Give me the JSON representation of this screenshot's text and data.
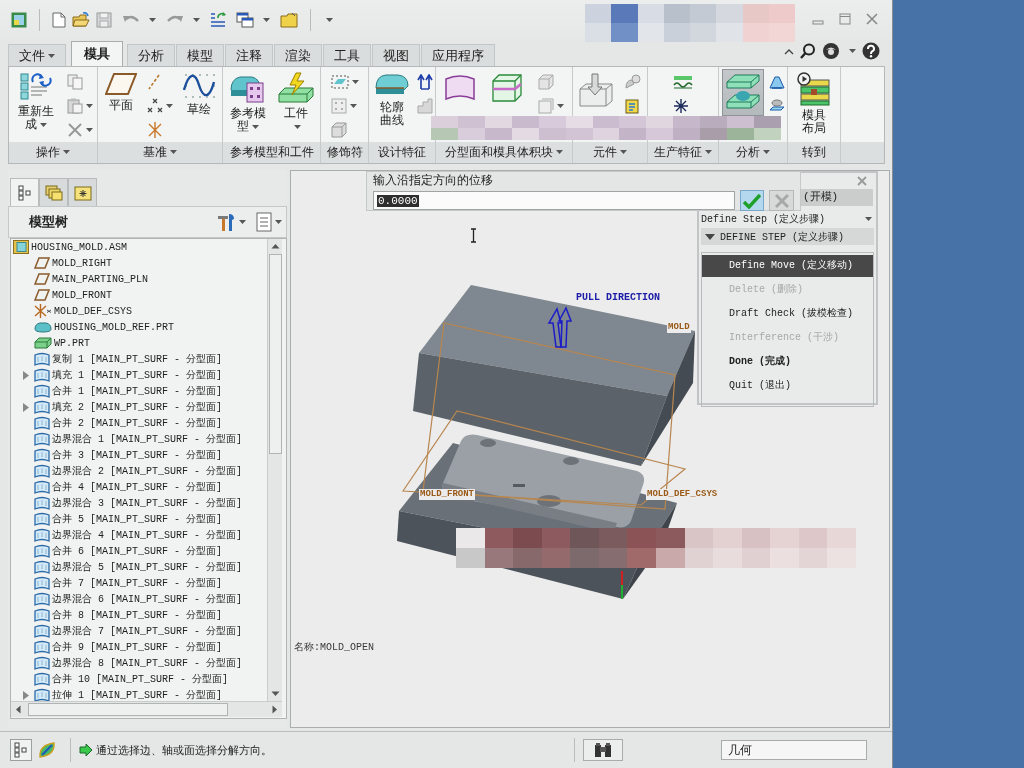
{
  "ribbon": {
    "tabs": [
      {
        "label": "文件",
        "menu": true,
        "selected": false
      },
      {
        "label": "模具",
        "menu": false,
        "selected": true
      },
      {
        "label": "分析",
        "menu": false,
        "selected": false
      },
      {
        "label": "模型",
        "menu": false,
        "selected": false
      },
      {
        "label": "注释",
        "menu": false,
        "selected": false
      },
      {
        "label": "渲染",
        "menu": false,
        "selected": false
      },
      {
        "label": "工具",
        "menu": false,
        "selected": false
      },
      {
        "label": "视图",
        "menu": false,
        "selected": false
      },
      {
        "label": "应用程序",
        "menu": false,
        "selected": false
      }
    ],
    "groups": [
      {
        "label": "操作",
        "menu": true,
        "buttons": [
          {
            "label": "重新生成",
            "menu": true,
            "pressed": false
          }
        ]
      },
      {
        "label": "基准",
        "menu": true,
        "buttons": [
          {
            "label": "平面",
            "menu": false,
            "pressed": false
          },
          {
            "label": "草绘",
            "menu": false,
            "pressed": false
          }
        ]
      },
      {
        "label": "参考模型和工件",
        "menu": false,
        "buttons": [
          {
            "label": "参考模型",
            "menu": true,
            "pressed": false
          },
          {
            "label": "工件",
            "menu": true,
            "pressed": false
          }
        ]
      },
      {
        "label": "修饰符",
        "menu": false
      },
      {
        "label": "设计特征",
        "menu": false,
        "buttons": [
          {
            "label": "轮廓曲线",
            "menu": false,
            "pressed": false
          }
        ]
      },
      {
        "label": "分型面和模具体积块",
        "menu": true
      },
      {
        "label": "元件",
        "menu": true
      },
      {
        "label": "生产特征",
        "menu": true
      },
      {
        "label": "分析",
        "menu": true,
        "buttons": [
          {
            "menu": false,
            "pressed": true
          }
        ]
      },
      {
        "label": "转到",
        "menu": false,
        "buttons": [
          {
            "label": "模具布局",
            "menu": false,
            "pressed": false
          }
        ]
      }
    ]
  },
  "model_tree": {
    "tabs": [
      {
        "selected": true
      },
      {
        "selected": false
      },
      {
        "selected": false
      }
    ],
    "title": "模型树",
    "root": {
      "label": "HOUSING_MOLD.ASM",
      "kind": "assembly",
      "children": [
        {
          "label": "MOLD_RIGHT",
          "kind": "plane",
          "expandable": false
        },
        {
          "label": "MAIN_PARTING_PLN",
          "kind": "plane",
          "expandable": false
        },
        {
          "label": "MOLD_FRONT",
          "kind": "plane",
          "expandable": false
        },
        {
          "label": "MOLD_DEF_CSYS",
          "kind": "csys",
          "expandable": false
        },
        {
          "label": "HOUSING_MOLD_REF.PRT",
          "kind": "part",
          "expandable": false
        },
        {
          "label": "WP.PRT",
          "kind": "workpiece",
          "expandable": false
        },
        {
          "label": "复制 1 [MAIN_PT_SURF - 分型面]",
          "kind": "surface",
          "expandable": false
        },
        {
          "label": "填充 1 [MAIN_PT_SURF - 分型面]",
          "kind": "surface",
          "expandable": true
        },
        {
          "label": "合并 1 [MAIN_PT_SURF - 分型面]",
          "kind": "surface",
          "expandable": false
        },
        {
          "label": "填充 2 [MAIN_PT_SURF - 分型面]",
          "kind": "surface",
          "expandable": true
        },
        {
          "label": "合并 2 [MAIN_PT_SURF - 分型面]",
          "kind": "surface",
          "expandable": false
        },
        {
          "label": "边界混合 1 [MAIN_PT_SURF - 分型面]",
          "kind": "surface",
          "expandable": false
        },
        {
          "label": "合并 3 [MAIN_PT_SURF - 分型面]",
          "kind": "surface",
          "expandable": false
        },
        {
          "label": "边界混合 2 [MAIN_PT_SURF - 分型面]",
          "kind": "surface",
          "expandable": false
        },
        {
          "label": "合并 4 [MAIN_PT_SURF - 分型面]",
          "kind": "surface",
          "expandable": false
        },
        {
          "label": "边界混合 3 [MAIN_PT_SURF - 分型面]",
          "kind": "surface",
          "expandable": false
        },
        {
          "label": "合并 5 [MAIN_PT_SURF - 分型面]",
          "kind": "surface",
          "expandable": false
        },
        {
          "label": "边界混合 4 [MAIN_PT_SURF - 分型面]",
          "kind": "surface",
          "expandable": false
        },
        {
          "label": "合并 6 [MAIN_PT_SURF - 分型面]",
          "kind": "surface",
          "expandable": false
        },
        {
          "label": "边界混合 5 [MAIN_PT_SURF - 分型面]",
          "kind": "surface",
          "expandable": false
        },
        {
          "label": "合并 7 [MAIN_PT_SURF - 分型面]",
          "kind": "surface",
          "expandable": false
        },
        {
          "label": "边界混合 6 [MAIN_PT_SURF - 分型面]",
          "kind": "surface",
          "expandable": false
        },
        {
          "label": "合并 8 [MAIN_PT_SURF - 分型面]",
          "kind": "surface",
          "expandable": false
        },
        {
          "label": "边界混合 7 [MAIN_PT_SURF - 分型面]",
          "kind": "surface",
          "expandable": false
        },
        {
          "label": "合并 9 [MAIN_PT_SURF - 分型面]",
          "kind": "surface",
          "expandable": false
        },
        {
          "label": "边界混合 8 [MAIN_PT_SURF - 分型面]",
          "kind": "surface",
          "expandable": false
        },
        {
          "label": "合并 10 [MAIN_PT_SURF - 分型面]",
          "kind": "surface",
          "expandable": false
        },
        {
          "label": "拉伸 1 [MAIN_PT_SURF - 分型面]",
          "kind": "surface",
          "expandable": true
        }
      ]
    }
  },
  "dialog": {
    "prompt": "输入沿指定方向的位移",
    "value": "0.0000",
    "value_selected": true,
    "accept": {
      "disabled": false
    },
    "cancel": {
      "disabled": true
    }
  },
  "menu_manager": {
    "title": "(开模)",
    "step": "Define Step (定义步骤)",
    "section": {
      "title": "DEFINE STEP (定义步骤)",
      "expanded": true
    },
    "items": [
      {
        "label": "Define Move (定义移动)",
        "selected": true,
        "disabled": false,
        "default": false
      },
      {
        "label": "Delete (删除)",
        "selected": false,
        "disabled": true,
        "default": false
      },
      {
        "label": "Draft Check (拔模检查)",
        "selected": false,
        "disabled": false,
        "default": false
      },
      {
        "label": "Interference (干涉)",
        "selected": false,
        "disabled": true,
        "default": false
      },
      {
        "label": "Done (完成)",
        "selected": false,
        "disabled": false,
        "default": true
      },
      {
        "label": "Quit (退出)",
        "selected": false,
        "disabled": false,
        "default": false
      }
    ]
  },
  "viewport": {
    "labels": [
      {
        "kind": "direction",
        "text": "PULL DIRECTION"
      },
      {
        "kind": "datum",
        "text": "MOLD"
      },
      {
        "kind": "datum",
        "text": "MOLD_FRONT"
      },
      {
        "kind": "datum",
        "text": "MOLD_DEF_CSYS"
      },
      {
        "kind": "info",
        "text": "名称:MOLD_OPEN"
      }
    ]
  },
  "status_bar": {
    "buttons": [
      {
        "selected": true
      },
      {
        "selected": false
      }
    ],
    "message": "通过选择边、轴或面选择分解方向。",
    "filter": "几何"
  }
}
